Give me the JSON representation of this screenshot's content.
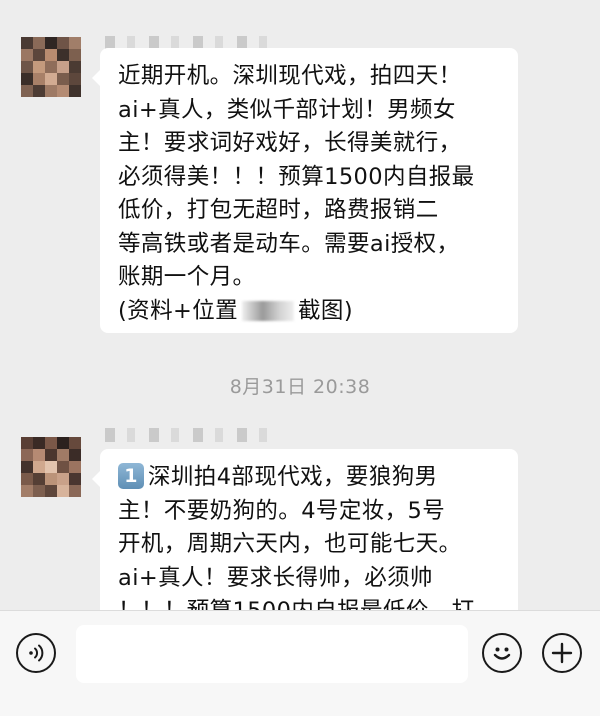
{
  "messages": [
    {
      "lines": [
        "近期开机。深圳现代戏，拍四天！",
        "ai+真人，类似千部计划！男频女",
        "主！要求词好戏好，长得美就行，",
        "必须得美！！！预算1500内自报最",
        "低价，打包无超时，路费报销二",
        "等高铁或者是动车。需要ai授权，",
        "账期一个月。"
      ],
      "tail_before": "(资料+位置",
      "tail_after": "截图)"
    },
    {
      "badge": "1",
      "lines": [
        "深圳拍4部现代戏，要狼狗男",
        "主！不要奶狗的。4号定妆，5号",
        "开机，周期六天内，也可能七天。",
        "ai+真人！要求长得帅，必须帅",
        "！！！预算1500内自报最低价，打"
      ]
    }
  ],
  "timestamp": "8月31日 20:38",
  "input_bar": {
    "voice_icon": "voice-wave-icon",
    "emoji_icon": "smiley-icon",
    "plus_icon": "plus-icon"
  },
  "colors": {
    "background": "#ededed",
    "bubble": "#ffffff",
    "timestamp_text": "#9a9a9a",
    "input_bar": "#f7f7f7"
  }
}
